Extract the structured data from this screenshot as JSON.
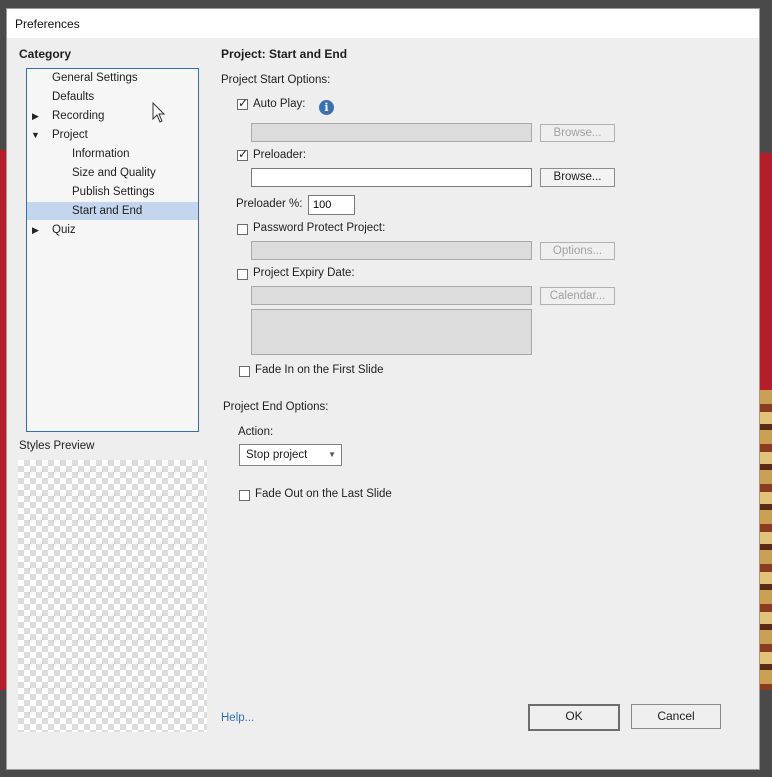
{
  "window": {
    "title": "Preferences"
  },
  "category": {
    "heading": "Category",
    "items": [
      {
        "label": "General Settings",
        "expand": ""
      },
      {
        "label": "Defaults",
        "expand": ""
      },
      {
        "label": "Recording",
        "expand": "▶"
      },
      {
        "label": "Project",
        "expand": "▼"
      },
      {
        "label": "Information",
        "expand": ""
      },
      {
        "label": "Size and Quality",
        "expand": ""
      },
      {
        "label": "Publish Settings",
        "expand": ""
      },
      {
        "label": "Start and End",
        "expand": "",
        "selected": true
      },
      {
        "label": "Quiz",
        "expand": "▶"
      }
    ]
  },
  "styles_preview": {
    "label": "Styles Preview"
  },
  "panel": {
    "title": "Project: Start and End",
    "start_options_label": "Project Start Options:",
    "auto_play": {
      "label": "Auto Play:",
      "checked": true,
      "browse_label": "Browse...",
      "path_value": ""
    },
    "preloader": {
      "label": "Preloader:",
      "checked": true,
      "browse_label": "Browse...",
      "path_value": ""
    },
    "preloader_percent": {
      "label": "Preloader %:",
      "value": "100"
    },
    "password": {
      "label": "Password Protect Project:",
      "checked": false,
      "options_label": "Options..."
    },
    "expiry": {
      "label": "Project Expiry Date:",
      "checked": false,
      "calendar_label": "Calendar..."
    },
    "fade_in": {
      "label": "Fade In on the First Slide",
      "checked": false
    },
    "end_options_label": "Project End Options:",
    "action": {
      "label": "Action:",
      "selected": "Stop project"
    },
    "fade_out": {
      "label": "Fade Out on the Last Slide",
      "checked": false
    }
  },
  "footer": {
    "help": "Help...",
    "ok": "OK",
    "cancel": "Cancel"
  },
  "icons": {
    "info": "info-icon",
    "checkmark": "✓",
    "dropdown": "chevron-down-icon"
  },
  "colors": {
    "selection": "#c4d5ee",
    "tree_border": "#2e6fb5",
    "link": "#2f6fb8",
    "info": "#3a6fb0"
  }
}
